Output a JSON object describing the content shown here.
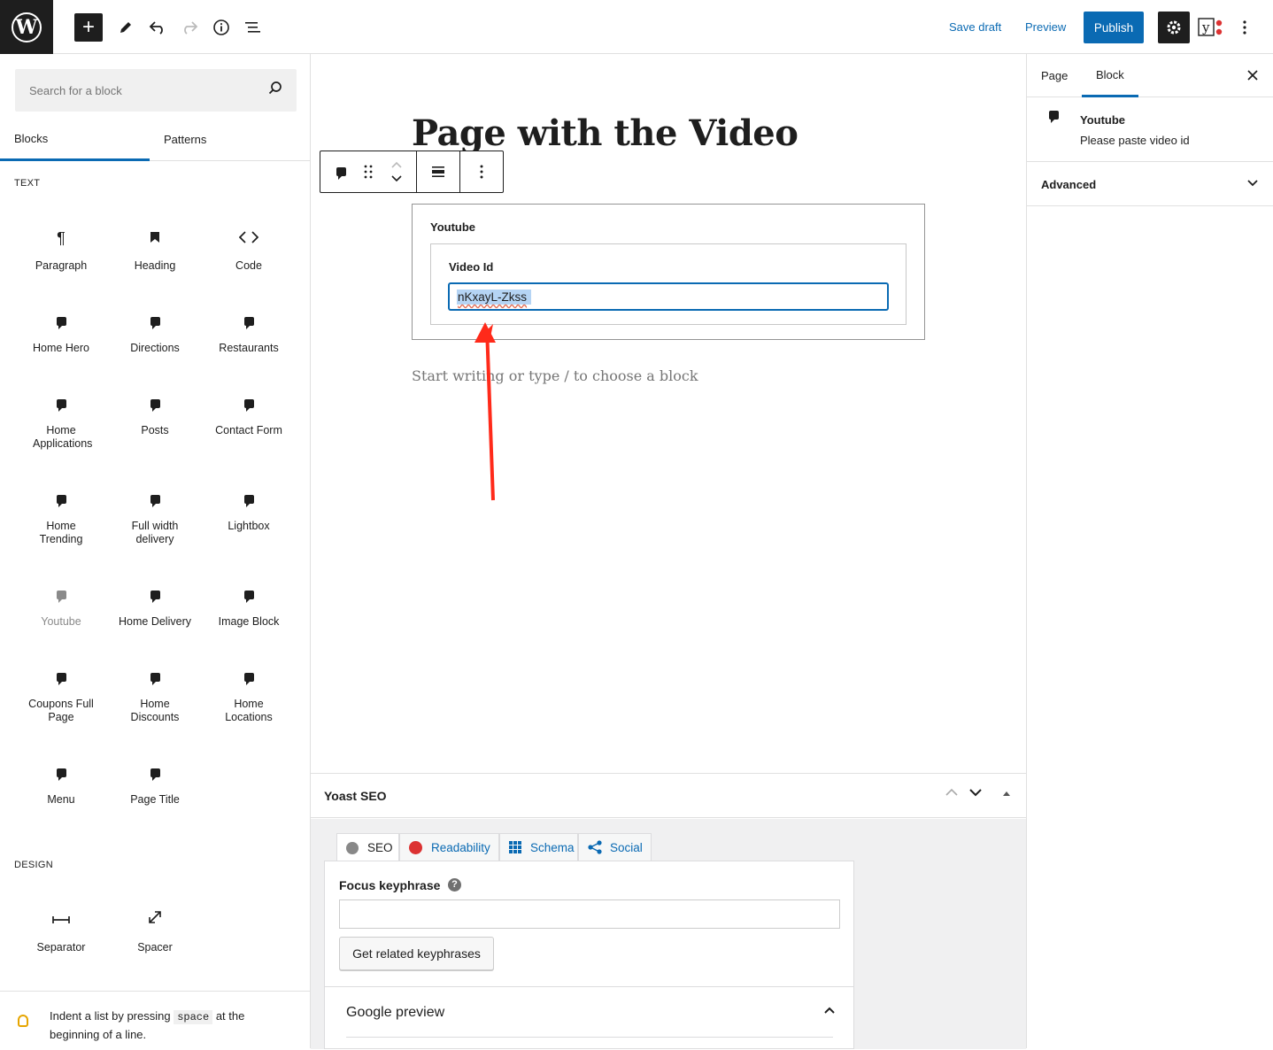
{
  "topbar": {
    "wp_logo": "W",
    "save_draft": "Save draft",
    "preview": "Preview",
    "publish": "Publish",
    "yoast_glyph": "y",
    "icons": [
      "add-block-icon",
      "edit-tools-icon",
      "undo-icon",
      "redo-icon",
      "info-icon",
      "list-view-icon",
      "settings-gear-icon",
      "yoast-icon",
      "more-options-icon"
    ]
  },
  "inserter": {
    "search_placeholder": "Search for a block",
    "tabs": [
      "Blocks",
      "Patterns"
    ],
    "categories": {
      "text": "TEXT",
      "design": "DESIGN"
    },
    "blocks": [
      {
        "label": "Paragraph",
        "icon": "¶"
      },
      {
        "label": "Heading",
        "icon": "bookmark"
      },
      {
        "label": "Code",
        "icon": "<>"
      },
      {
        "label": "Home Hero",
        "icon": "bubble"
      },
      {
        "label": "Directions",
        "icon": "bubble"
      },
      {
        "label": "Restaurants",
        "icon": "bubble"
      },
      {
        "label": "Home Applications",
        "icon": "bubble"
      },
      {
        "label": "Posts",
        "icon": "bubble"
      },
      {
        "label": "Contact Form",
        "icon": "bubble"
      },
      {
        "label": "Home Trending",
        "icon": "bubble"
      },
      {
        "label": "Full width delivery",
        "icon": "bubble"
      },
      {
        "label": "Lightbox",
        "icon": "bubble"
      },
      {
        "label": "Youtube",
        "icon": "bubble",
        "disabled": true
      },
      {
        "label": "Home Delivery",
        "icon": "bubble"
      },
      {
        "label": "Image Block",
        "icon": "bubble"
      },
      {
        "label": "Coupons Full Page",
        "icon": "bubble"
      },
      {
        "label": "Home Discounts",
        "icon": "bubble"
      },
      {
        "label": "Home Locations",
        "icon": "bubble"
      },
      {
        "label": "Menu",
        "icon": "bubble"
      },
      {
        "label": "Page Title",
        "icon": "bubble"
      }
    ],
    "design_blocks": [
      {
        "label": "Separator",
        "icon": "separator"
      },
      {
        "label": "Spacer",
        "icon": "spacer"
      }
    ],
    "tip": {
      "before": "Indent a list by pressing ",
      "key": "space",
      "after": " at the beginning of a line."
    }
  },
  "canvas": {
    "page_title": "Page with the Video",
    "youtube_block": {
      "title": "Youtube",
      "field_label": "Video Id",
      "field_value": "nKxayL-Zkss"
    },
    "placeholder": "Start writing or type / to choose a block"
  },
  "yoast": {
    "title": "Yoast SEO",
    "tabs": [
      "SEO",
      "Readability",
      "Schema",
      "Social"
    ],
    "focus_keyphrase_label": "Focus keyphrase",
    "related_button": "Get related keyphrases",
    "google_preview": "Google preview"
  },
  "sidebar": {
    "tabs": [
      "Page",
      "Block"
    ],
    "block_title": "Youtube",
    "block_description": "Please paste video id",
    "advanced": "Advanced"
  },
  "colors": {
    "accent": "#0a6ab3",
    "dark": "#1e1e1e",
    "annotation_arrow": "#ff2a1a"
  }
}
